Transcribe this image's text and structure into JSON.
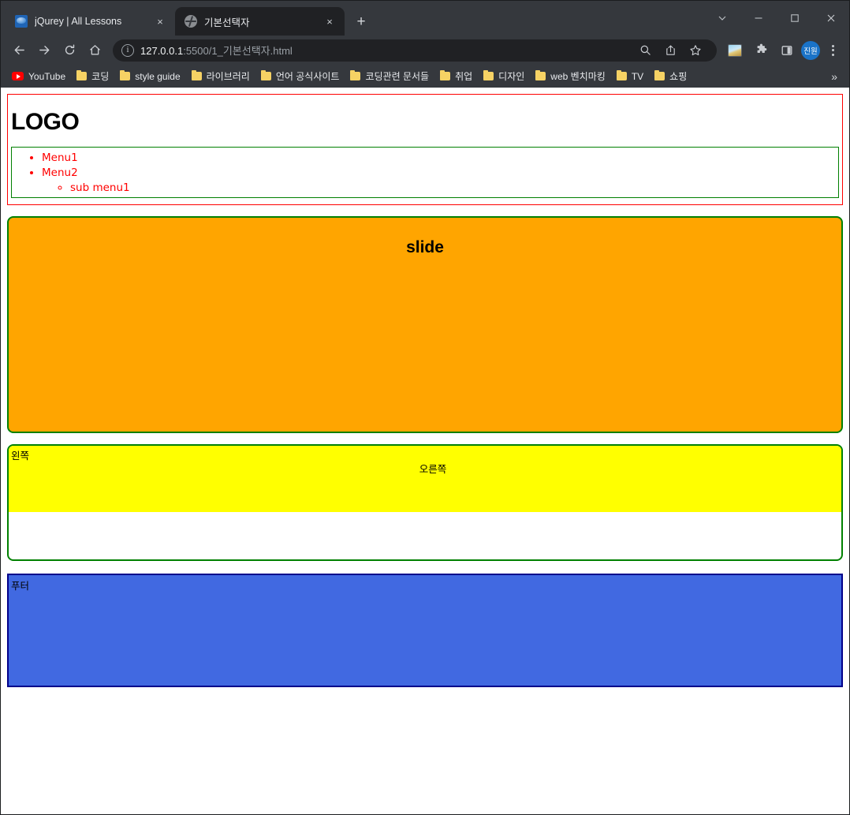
{
  "browser": {
    "tabs": [
      {
        "title": "jQurey | All Lessons",
        "favicon": "jquery-icon",
        "active": false,
        "close_label": "×"
      },
      {
        "title": "기본선택자",
        "favicon": "globe-icon",
        "active": true,
        "close_label": "×"
      }
    ],
    "new_tab_label": "+",
    "window_controls": {
      "tab_search": "∨",
      "minimize": "—",
      "maximize": "□",
      "close": "✕"
    },
    "toolbar": {
      "back": "back-arrow-icon",
      "forward": "forward-arrow-icon",
      "reload": "reload-icon",
      "home": "home-icon",
      "info_icon": "ⓘ",
      "url_host": "127.0.0.1",
      "url_path": ":5500/1_기본선택자.html",
      "url_full": "127.0.0.1:5500/1_기본선택자.html",
      "search_icon": "search-icon",
      "share_icon": "share-icon",
      "bookmark_icon": "star-icon",
      "extension_image_icon": "image-extension-icon",
      "extensions_icon": "puzzle-icon",
      "sidepanel_icon": "side-panel-icon",
      "profile_initials": "진원",
      "menu_icon": "kebab-menu-icon"
    },
    "bookmarks": [
      {
        "label": "YouTube",
        "icon": "youtube-icon"
      },
      {
        "label": "코딩",
        "icon": "folder-icon"
      },
      {
        "label": "style guide",
        "icon": "folder-icon"
      },
      {
        "label": "라이브러리",
        "icon": "folder-icon"
      },
      {
        "label": "언어 공식사이트",
        "icon": "folder-icon"
      },
      {
        "label": "코딩관련 문서들",
        "icon": "folder-icon"
      },
      {
        "label": "취업",
        "icon": "folder-icon"
      },
      {
        "label": "디자인",
        "icon": "folder-icon"
      },
      {
        "label": "web 벤치마킹",
        "icon": "folder-icon"
      },
      {
        "label": "TV",
        "icon": "folder-icon"
      },
      {
        "label": "쇼핑",
        "icon": "folder-icon"
      }
    ],
    "bookmarks_overflow": "»"
  },
  "page": {
    "header": {
      "logo": "LOGO",
      "nav": {
        "items": [
          {
            "label": "Menu1"
          },
          {
            "label": "Menu2",
            "sub": [
              {
                "label": "sub menu1"
              }
            ]
          }
        ]
      }
    },
    "slide": {
      "title": "slide"
    },
    "content": {
      "left_label": "왼쪽",
      "right_label": "오른쪽"
    },
    "footer": {
      "label": "푸터"
    }
  },
  "colors": {
    "header_border": "#ff0000",
    "nav_border": "#008000",
    "nav_text": "#ff0000",
    "slide_bg": "#ffa500",
    "content_border": "#008000",
    "left_bg": "#ffff00",
    "footer_bg": "#4169e1",
    "footer_border": "#00008b",
    "chrome_bg": "#35383d",
    "tab_active_bg": "#202124",
    "avatar_bg": "#1a73c8"
  }
}
